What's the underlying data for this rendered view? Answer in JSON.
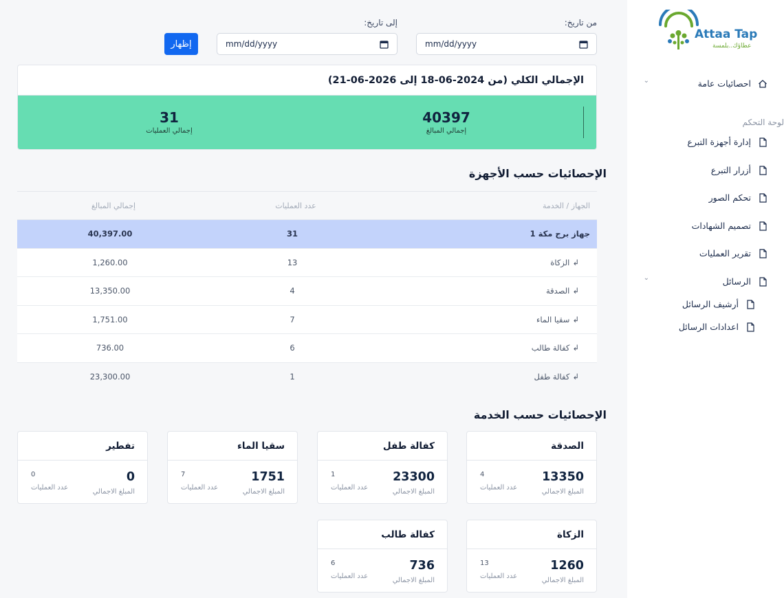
{
  "sidebar": {
    "logo": {
      "brand": "Attaa Tap",
      "tagline": "عطاؤك..بلمسة"
    },
    "general_stats": "احصائيات عامة",
    "section_label": "لوحة التحكم",
    "items": [
      {
        "label": "إدارة أجهزة التبرع",
        "icon": "file-icon"
      },
      {
        "label": "أزرار التبرع",
        "icon": "file-icon"
      },
      {
        "label": "تحكم الصور",
        "icon": "file-icon"
      },
      {
        "label": "تصميم الشهادات",
        "icon": "file-icon"
      },
      {
        "label": "تقرير العمليات",
        "icon": "file-icon"
      }
    ],
    "messages": {
      "label": "الرسائل",
      "children": [
        {
          "label": "أرشيف الرسائل",
          "icon": "file-icon"
        },
        {
          "label": "اعدادات الرسائل",
          "icon": "file-icon"
        }
      ]
    }
  },
  "filters": {
    "from_label": "من تاريخ:",
    "to_label": "إلى تاريخ:",
    "from_placeholder": "mm/dd/yyyy",
    "to_placeholder": "mm/dd/yyyy",
    "show_button": "إظهار"
  },
  "summary": {
    "title": "الإجمالي الكلي (من 2024-06-18 إلى 2026-06-21)",
    "total_amount": "40397",
    "total_amount_label": "إجمالي المبالغ",
    "total_ops": "31",
    "total_ops_label": "إجمالي العمليات",
    "band_color": "#66ddb2"
  },
  "devices_section": {
    "title": "الإحصائيات حسب الأجهزة",
    "columns": [
      "الجهاز / الخدمة",
      "عدد العمليات",
      "إجمالي المبالغ"
    ],
    "rows": [
      {
        "name": "جهاز برج مكة 1",
        "count": "31",
        "amount": "40,397.00",
        "sub": false
      },
      {
        "name": "الزكاة",
        "count": "13",
        "amount": "1,260.00",
        "sub": true
      },
      {
        "name": "الصدقة",
        "count": "4",
        "amount": "13,350.00",
        "sub": true
      },
      {
        "name": "سقيا الماء",
        "count": "7",
        "amount": "1,751.00",
        "sub": true
      },
      {
        "name": "كفالة طالب",
        "count": "6",
        "amount": "736.00",
        "sub": true
      },
      {
        "name": "كفالة طفل",
        "count": "1",
        "amount": "23,300.00",
        "sub": true
      }
    ],
    "sub_marker": "↲"
  },
  "services_section": {
    "title": "الإحصائيات حسب الخدمة",
    "amount_label": "المبلغ الاجمالي",
    "count_label": "عدد العمليات",
    "cards": [
      {
        "title": "الصدقة",
        "amount": "13350",
        "count": "4"
      },
      {
        "title": "كفالة طفل",
        "amount": "23300",
        "count": "1"
      },
      {
        "title": "سقيا الماء",
        "amount": "1751",
        "count": "7"
      },
      {
        "title": "تفطير",
        "amount": "0",
        "count": "0"
      },
      {
        "title": "الزكاة",
        "amount": "1260",
        "count": "13"
      },
      {
        "title": "كفالة طالب",
        "amount": "736",
        "count": "6"
      }
    ]
  },
  "colors": {
    "primary": "#1268f0",
    "highlight_row": "#c3d3fb",
    "summary_band": "#66ddb2"
  }
}
